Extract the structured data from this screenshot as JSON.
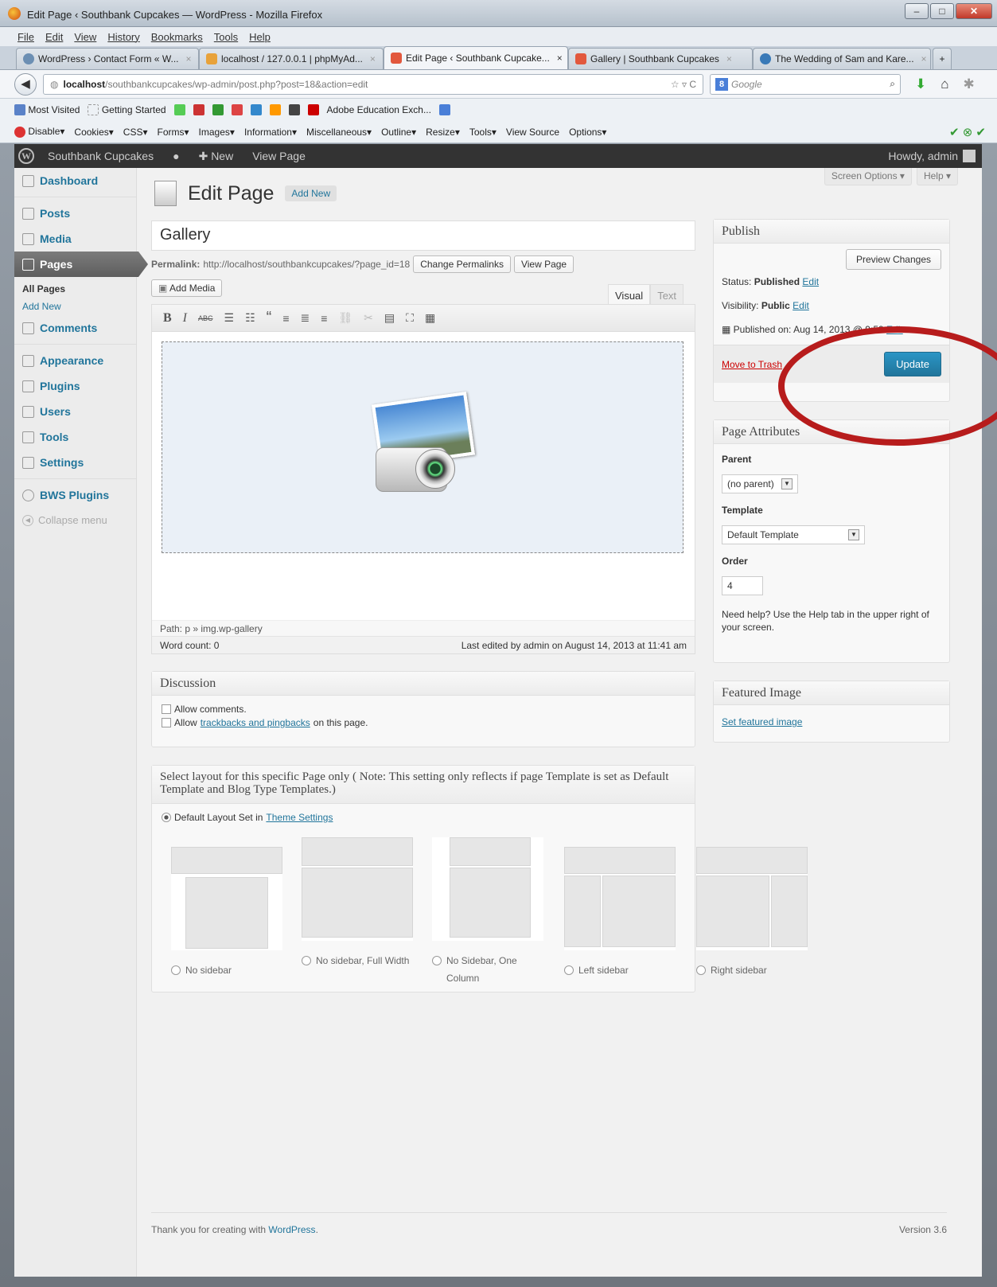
{
  "browser": {
    "title": "Edit Page ‹ Southbank Cupcakes — WordPress - Mozilla Firefox",
    "menu": [
      "File",
      "Edit",
      "View",
      "History",
      "Bookmarks",
      "Tools",
      "Help"
    ],
    "tabs": [
      {
        "label": "WordPress › Contact Form « W...",
        "color": "#6c8fb3"
      },
      {
        "label": "localhost / 127.0.0.1 | phpMyAd...",
        "color": "#e8a23a"
      },
      {
        "label": "Edit Page ‹ Southbank Cupcake...",
        "color": "#e2583d",
        "active": true
      },
      {
        "label": "Gallery | Southbank Cupcakes",
        "color": "#e2583d"
      },
      {
        "label": "The Wedding of Sam and Kare...",
        "color": "#3a7ab8"
      }
    ],
    "url_host": "localhost",
    "url_path": "/southbankcupcakes/wp-admin/post.php?post=18&action=edit",
    "search_placeholder": "Google",
    "bookmarks": [
      "Most Visited",
      "Getting Started",
      "Adobe Education Exch..."
    ],
    "webdev": [
      "Disable",
      "Cookies",
      "CSS",
      "Forms",
      "Images",
      "Information",
      "Miscellaneous",
      "Outline",
      "Resize",
      "Tools",
      "View Source",
      "Options"
    ]
  },
  "adminbar": {
    "site": "Southbank Cupcakes",
    "new": "New",
    "view": "View Page",
    "howdy": "Howdy, admin"
  },
  "sidebar": {
    "items": [
      "Dashboard",
      "Posts",
      "Media",
      "Pages",
      "Comments",
      "Appearance",
      "Plugins",
      "Users",
      "Tools",
      "Settings",
      "BWS Plugins"
    ],
    "sub_all": "All Pages",
    "sub_add": "Add New",
    "collapse": "Collapse menu"
  },
  "main": {
    "screen_options": "Screen Options ▾",
    "help": "Help ▾",
    "heading": "Edit Page",
    "add_new": "Add New",
    "title_value": "Gallery",
    "permalink_label": "Permalink:",
    "permalink_url": "http://localhost/southbankcupcakes/?page_id=18",
    "change_permalinks": "Change Permalinks",
    "view_page": "View Page",
    "add_media": "Add Media",
    "tab_visual": "Visual",
    "tab_text": "Text",
    "path": "Path: p » img.wp-gallery",
    "word_count": "Word count: 0",
    "last_edited": "Last edited by admin on August 14, 2013 at 11:41 am"
  },
  "discussion": {
    "title": "Discussion",
    "allow_comments": "Allow comments.",
    "allow_prefix": "Allow",
    "trackbacks_link": "trackbacks and pingbacks",
    "allow_suffix": "on this page."
  },
  "layout": {
    "title": "Select layout for this specific Page only ( Note: This setting only reflects if page Template is set as Default Template and Blog Type Templates.)",
    "default_prefix": "Default Layout Set in",
    "theme_settings": "Theme Settings",
    "options": [
      "No sidebar",
      "No sidebar, Full Width",
      "No Sidebar, One Column",
      "Left sidebar",
      "Right sidebar"
    ]
  },
  "publish": {
    "title": "Publish",
    "preview": "Preview Changes",
    "status_label": "Status:",
    "status_value": "Published",
    "visibility_label": "Visibility:",
    "visibility_value": "Public",
    "edit": "Edit",
    "published_on": "Published on: Aug 14, 2013 @ 9:59",
    "trash": "Move to Trash",
    "update": "Update"
  },
  "attributes": {
    "title": "Page Attributes",
    "parent_label": "Parent",
    "parent_value": "(no parent)",
    "template_label": "Template",
    "template_value": "Default Template",
    "order_label": "Order",
    "order_value": "4",
    "help": "Need help? Use the Help tab in the upper right of your screen."
  },
  "featured": {
    "title": "Featured Image",
    "link": "Set featured image"
  },
  "footer": {
    "thanks": "Thank you for creating with",
    "wordpress": "WordPress",
    "version": "Version 3.6"
  },
  "colors": {
    "link": "#21759b",
    "annotation": "#b71c1c",
    "update_button": "#21759b"
  }
}
